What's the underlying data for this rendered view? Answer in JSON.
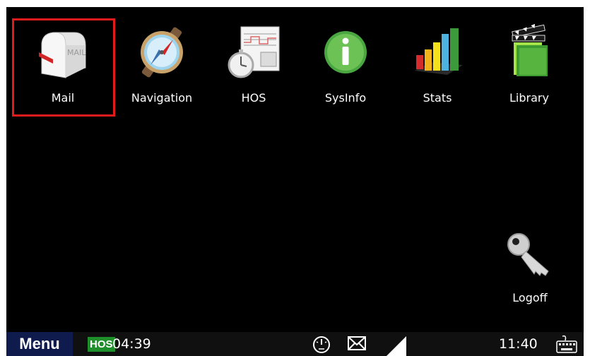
{
  "apps": [
    {
      "label": "Mail",
      "icon": "mailbox-icon",
      "selected": true
    },
    {
      "label": "Navigation",
      "icon": "compass-icon"
    },
    {
      "label": "HOS",
      "icon": "logbook-stopwatch-icon"
    },
    {
      "label": "SysInfo",
      "icon": "info-icon"
    },
    {
      "label": "Stats",
      "icon": "bar-chart-icon"
    },
    {
      "label": "Library",
      "icon": "books-icon"
    }
  ],
  "mail_icon_text": "MAIL",
  "logoff": {
    "label": "Logoff",
    "icon": "key-icon"
  },
  "statusbar": {
    "menu_label": "Menu",
    "hos_badge": "HOS",
    "hos_time": "04:39",
    "clock": "11:40",
    "icons": [
      "speedometer-icon",
      "envelope-icon",
      "signal-strength-icon",
      "keyboard-icon"
    ]
  },
  "colors": {
    "background": "#000000",
    "selection_border": "#e21b1b",
    "menu_bg": "#0f1b4d",
    "hos_badge_bg": "#1f8f2b"
  }
}
